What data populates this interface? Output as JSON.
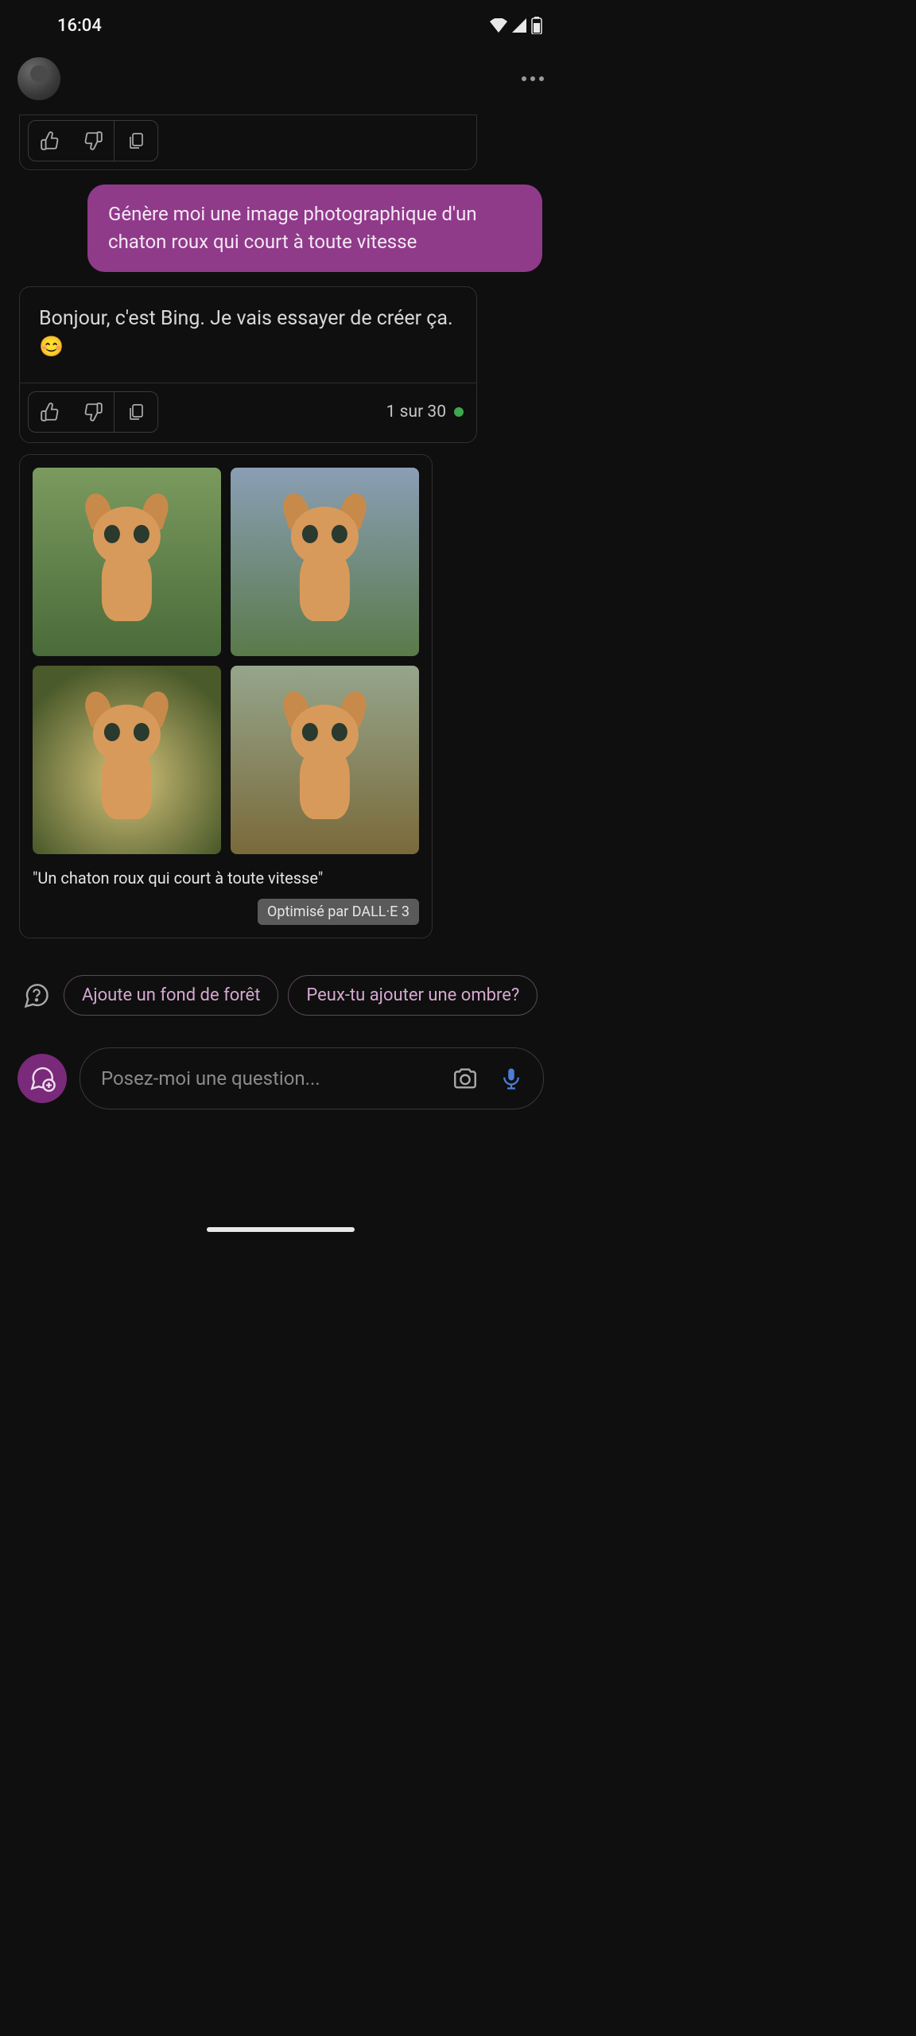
{
  "status": {
    "time": "16:04"
  },
  "messages": {
    "user1": "Génère moi une image photographique d'un chaton roux qui court à toute vitesse",
    "ai1": "Bonjour, c'est Bing. Je vais essayer de créer ça. 😊",
    "counter": "1 sur 30"
  },
  "image_card": {
    "caption": "\"Un chaton roux qui court à toute vitesse\"",
    "badge": "Optimisé par DALL·E 3"
  },
  "suggestions": {
    "s1": "Ajoute un fond de forêt",
    "s2": "Peux-tu ajouter une ombre?"
  },
  "composer": {
    "placeholder": "Posez-moi une question..."
  }
}
